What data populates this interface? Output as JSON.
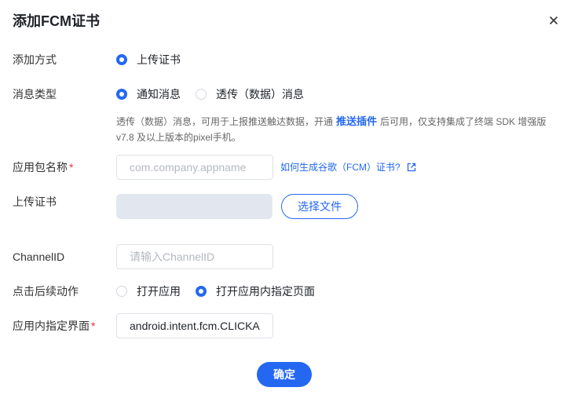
{
  "dialog": {
    "title": "添加FCM证书",
    "close_icon": "close-icon"
  },
  "form": {
    "add_method": {
      "label": "添加方式",
      "options": [
        {
          "label": "上传证书",
          "selected": true
        }
      ]
    },
    "message_type": {
      "label": "消息类型",
      "options": [
        {
          "label": "通知消息",
          "selected": true
        },
        {
          "label": "透传（数据）消息",
          "selected": false
        }
      ],
      "help": {
        "text_before": "透传（数据）消息，可用于上报推送触达数据，开通",
        "link": "推送插件",
        "text_after": "后可用，仅支持集成了终端 SDK 增强版",
        "line2": "v7.8 及以上版本的pixel手机。"
      }
    },
    "package_name": {
      "label": "应用包名称",
      "required_mark": "*",
      "placeholder": "com.company.appname",
      "help_link": "如何生成谷歌（FCM）证书?",
      "help_link_icon": "external-link-icon"
    },
    "upload": {
      "label": "上传证书",
      "button_label": "选择文件"
    },
    "channel_id": {
      "label": "ChannelID",
      "placeholder": "请输入ChannelID"
    },
    "click_action": {
      "label": "点击后续动作",
      "options": [
        {
          "label": "打开应用",
          "selected": false
        },
        {
          "label": "打开应用内指定页面",
          "selected": true
        }
      ]
    },
    "target_page": {
      "label": "应用内指定界面",
      "required_mark": "*",
      "value": "android.intent.fcm.CLICKA"
    }
  },
  "footer": {
    "confirm_label": "确定"
  },
  "colors": {
    "primary": "#2468f2",
    "required": "#e5322d"
  }
}
